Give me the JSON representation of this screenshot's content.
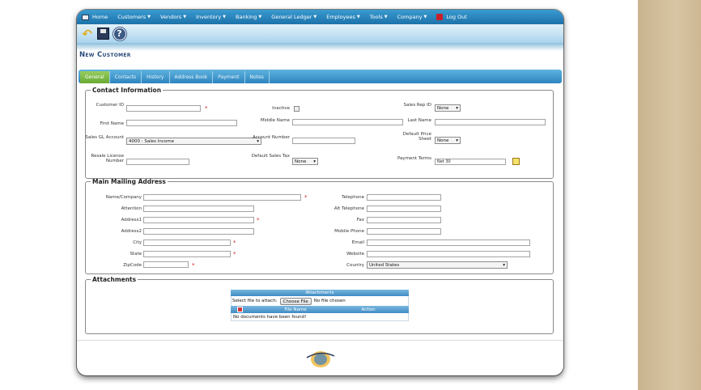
{
  "menu": {
    "home": "Home",
    "items": [
      "Customers",
      "Vendors",
      "Inventory",
      "Banking",
      "General Ledger",
      "Employees",
      "Tools",
      "Company"
    ],
    "logout": "Log Out"
  },
  "page": {
    "title": "New Customer"
  },
  "tabs": [
    "General",
    "Contacts",
    "History",
    "Address Book",
    "Payment",
    "Notes"
  ],
  "contact": {
    "legend": "Contact Information",
    "customer_id": "Customer ID",
    "inactive": "Inactive",
    "sales_rep_id": "Sales Rep ID",
    "sales_rep_value": "None",
    "first_name": "First Name",
    "middle_name": "Middle Name",
    "last_name": "Last Name",
    "sales_gl_account": "Sales GL Account",
    "sales_gl_value": "4000 : Sales Income",
    "account_number": "Account Number",
    "default_price_sheet": "Default Price Sheet",
    "price_sheet_value": "None",
    "resale_license": "Resale License Number",
    "default_sales_tax": "Default Sales Tax",
    "sales_tax_value": "None",
    "payment_terms": "Payment Terms",
    "payment_terms_value": "Net 30"
  },
  "mailing": {
    "legend": "Main Mailing Address",
    "name_company": "Name/Company",
    "attention": "Attention",
    "address1": "Address1",
    "address2": "Address2",
    "city": "City",
    "state": "State",
    "zipcode": "ZipCode",
    "telephone": "Telephone",
    "alt_telephone": "Alt Telephone",
    "fax": "Fax",
    "mobile_phone": "Mobile Phone",
    "email": "Email",
    "website": "Website",
    "country": "Country",
    "country_value": "United States"
  },
  "attachments": {
    "legend": "Attachments",
    "table_title": "Attachments",
    "select_label": "Select file to attach:",
    "choose_button": "Choose File",
    "no_file": "No file chosen",
    "col_file_name": "File Name",
    "col_action": "Action",
    "empty": "No documents have been found!"
  },
  "colors": {
    "menu_blue": "#1c72aa",
    "active_tab_green": "#6aaa35",
    "required_red": "#d62020"
  },
  "icons": [
    "home-icon",
    "logout-icon",
    "back-arrow-icon",
    "save-icon",
    "help-icon",
    "note-icon",
    "delete-icon",
    "company-logo"
  ]
}
